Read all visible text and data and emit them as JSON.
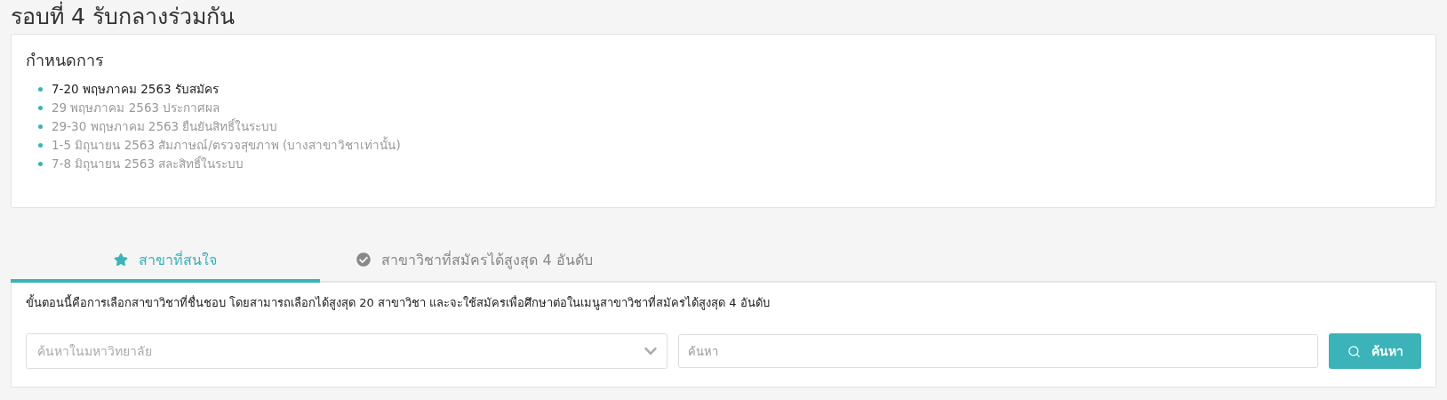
{
  "page_title": "รอบที่ 4 รับกลางร่วมกัน",
  "schedule": {
    "heading": "กำหนดการ",
    "items": [
      {
        "text": "7-20 พฤษภาคม 2563 รับสมัคร",
        "active": true
      },
      {
        "text": "29 พฤษภาคม 2563 ประกาศผล",
        "active": false
      },
      {
        "text": "29-30 พฤษภาคม 2563 ยืนยันสิทธิ์ในระบบ",
        "active": false
      },
      {
        "text": "1-5 มิถุนายน 2563 สัมภาษณ์/ตรวจสุขภาพ (บางสาขาวิชาเท่านั้น)",
        "active": false
      },
      {
        "text": "7-8 มิถุนายน 2563 สละสิทธิ์ในระบบ",
        "active": false
      }
    ]
  },
  "tabs": [
    {
      "label": "สาขาที่สนใจ",
      "kind": "star",
      "selected": true
    },
    {
      "label": "สาขาวิชาที่สมัครได้สูงสุด 4 อันดับ",
      "kind": "check",
      "selected": false
    }
  ],
  "panel": {
    "description": "ขั้นตอนนี้คือการเลือกสาขาวิชาที่ชื่นชอบ โดยสามารถเลือกได้สูงสุด 20 สาขาวิชา และจะใช้สมัครเพื่อศึกษาต่อในเมนูสาขาวิชาที่สมัครได้สูงสุด 4 อันดับ",
    "university_select": {
      "placeholder": "ค้นหาในมหาวิทยาลัย"
    },
    "search_field": {
      "placeholder": "ค้นหา"
    },
    "search_button": {
      "label": "ค้นหา"
    }
  }
}
